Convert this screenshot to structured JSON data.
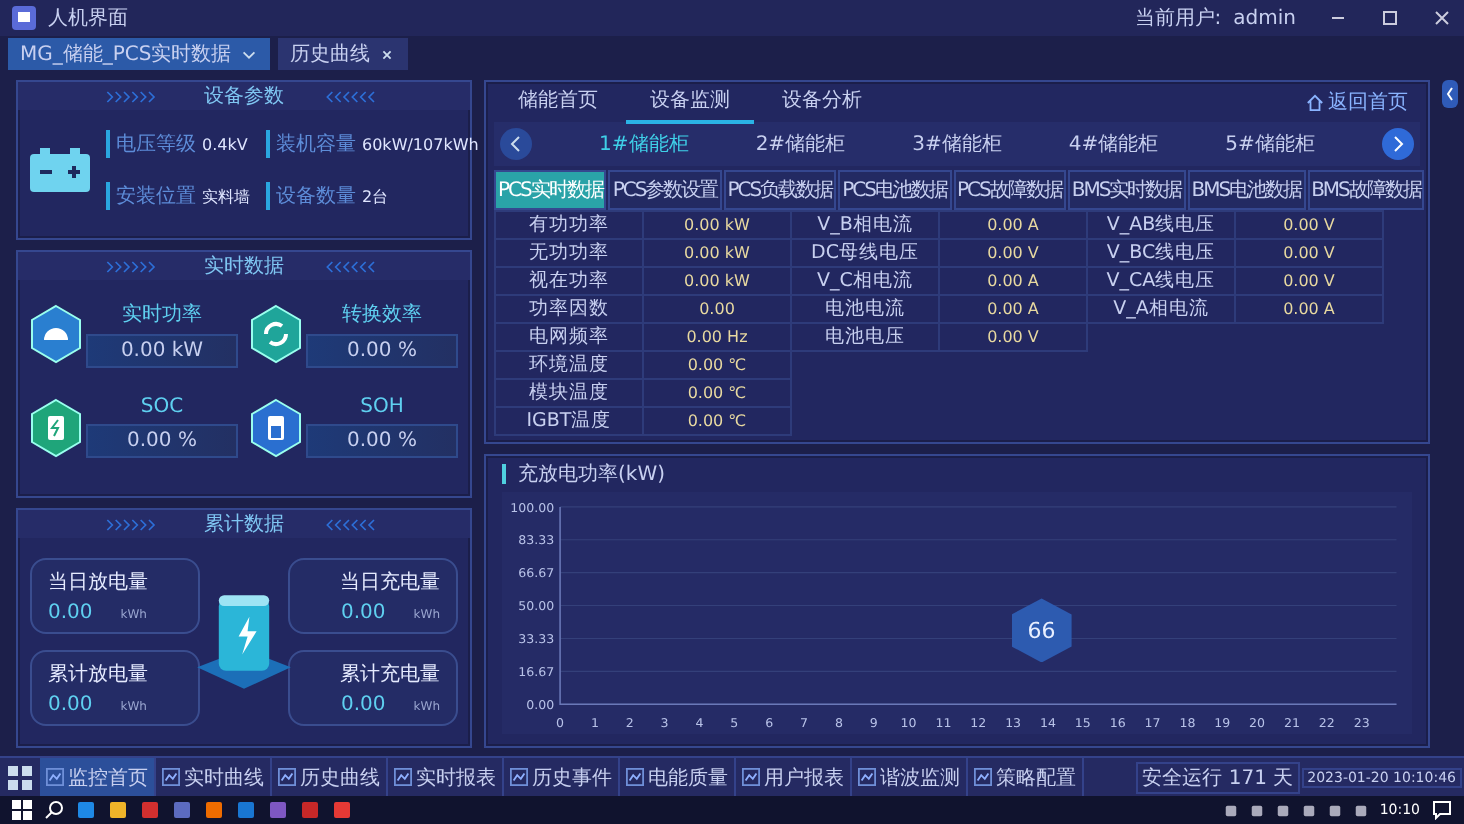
{
  "window": {
    "title": "人机界面",
    "user_label": "当前用户:",
    "user": "admin"
  },
  "doc_tabs": [
    {
      "label": "MG_储能_PCS实时数据",
      "selected": true
    },
    {
      "label": "历史曲线",
      "selected": false
    }
  ],
  "device_params": {
    "title": "设备参数",
    "fields": [
      {
        "label": "电压等级",
        "value": "0.4kV"
      },
      {
        "label": "装机容量",
        "value": "60kW/107kWh"
      },
      {
        "label": "安装位置",
        "value": "实料墙"
      },
      {
        "label": "设备数量",
        "value": "2台"
      }
    ]
  },
  "realtime": {
    "title": "实时数据",
    "metrics": [
      {
        "label": "实时功率",
        "value": "0.00 kW",
        "kind": "gauge"
      },
      {
        "label": "转换效率",
        "value": "0.00 %",
        "kind": "cycle"
      },
      {
        "label": "SOC",
        "value": "0.00 %",
        "kind": "charge"
      },
      {
        "label": "SOH",
        "value": "0.00 %",
        "kind": "battery"
      }
    ]
  },
  "cumulative": {
    "title": "累计数据",
    "items": [
      {
        "label": "当日放电量",
        "value": "0.00",
        "unit": "kWh"
      },
      {
        "label": "当日充电量",
        "value": "0.00",
        "unit": "kWh"
      },
      {
        "label": "累计放电量",
        "value": "0.00",
        "unit": "kWh"
      },
      {
        "label": "累计充电量",
        "value": "0.00",
        "unit": "kWh"
      }
    ]
  },
  "main_tabs": [
    {
      "label": "储能首页",
      "selected": false
    },
    {
      "label": "设备监测",
      "selected": true
    },
    {
      "label": "设备分析",
      "selected": false
    }
  ],
  "home_link": "返回首页",
  "cabinets": [
    {
      "label": "1#储能柜",
      "selected": true
    },
    {
      "label": "2#储能柜",
      "selected": false
    },
    {
      "label": "3#储能柜",
      "selected": false
    },
    {
      "label": "4#储能柜",
      "selected": false
    },
    {
      "label": "5#储能柜",
      "selected": false
    }
  ],
  "data_tabs": [
    {
      "label": "PCS实时数据",
      "selected": true
    },
    {
      "label": "PCS参数设置",
      "selected": false
    },
    {
      "label": "PCS负载数据",
      "selected": false
    },
    {
      "label": "PCS电池数据",
      "selected": false
    },
    {
      "label": "PCS故障数据",
      "selected": false
    },
    {
      "label": "BMS实时数据",
      "selected": false
    },
    {
      "label": "BMS电池数据",
      "selected": false
    },
    {
      "label": "BMS故障数据",
      "selected": false
    }
  ],
  "table": {
    "groups": [
      {
        "rows": [
          {
            "label": "有功功率",
            "value": "0.00 kW"
          },
          {
            "label": "无功功率",
            "value": "0.00 kW"
          },
          {
            "label": "视在功率",
            "value": "0.00 kW"
          },
          {
            "label": "功率因数",
            "value": "0.00"
          },
          {
            "label": "电网频率",
            "value": "0.00 Hz"
          },
          {
            "label": "环境温度",
            "value": "0.00 ℃"
          },
          {
            "label": "模块温度",
            "value": "0.00 ℃"
          },
          {
            "label": "IGBT温度",
            "value": "0.00 ℃"
          }
        ]
      },
      {
        "rows": [
          {
            "label": "V_B相电流",
            "value": "0.00 A"
          },
          {
            "label": "DC母线电压",
            "value": "0.00 V"
          },
          {
            "label": "V_C相电流",
            "value": "0.00 A"
          },
          {
            "label": "电池电流",
            "value": "0.00 A"
          },
          {
            "label": "电池电压",
            "value": "0.00 V"
          }
        ]
      },
      {
        "rows": [
          {
            "label": "V_AB线电压",
            "value": "0.00 V"
          },
          {
            "label": "V_BC线电压",
            "value": "0.00 V"
          },
          {
            "label": "V_CA线电压",
            "value": "0.00 V"
          },
          {
            "label": "V_A相电流",
            "value": "0.00 A"
          }
        ]
      }
    ]
  },
  "chart": {
    "title": "充放电功率(kW)",
    "chart_data": {
      "type": "line",
      "grid": true,
      "xlim": [
        0,
        24
      ],
      "ylim": [
        0,
        100
      ],
      "xticks": [
        0,
        1,
        2,
        3,
        4,
        5,
        6,
        7,
        8,
        9,
        10,
        11,
        12,
        13,
        14,
        15,
        16,
        17,
        18,
        19,
        20,
        21,
        22,
        23
      ],
      "yticks": [
        {
          "value": 0,
          "label": "0.00"
        },
        {
          "value": 16.67,
          "label": "16.67"
        },
        {
          "value": 33.33,
          "label": "33.33"
        },
        {
          "value": 50,
          "label": "50.00"
        },
        {
          "value": 66.67,
          "label": "66.67"
        },
        {
          "value": 83.33,
          "label": "83.33"
        },
        {
          "value": 100,
          "label": "100.00"
        }
      ]
    }
  },
  "floating_badge": {
    "value": "66"
  },
  "bottom_nav": [
    {
      "label": "监控首页",
      "selected": true
    },
    {
      "label": "实时曲线",
      "selected": false
    },
    {
      "label": "历史曲线",
      "selected": false
    },
    {
      "label": "实时报表",
      "selected": false
    },
    {
      "label": "历史事件",
      "selected": false
    },
    {
      "label": "电能质量",
      "selected": false
    },
    {
      "label": "用户报表",
      "selected": false
    },
    {
      "label": "谐波监测",
      "selected": false
    },
    {
      "label": "策略配置",
      "selected": false
    }
  ],
  "status": {
    "runtime": "安全运行 171 天",
    "datetime": "2023-01-20 10:10:46"
  },
  "taskbar": {
    "time": "10:10"
  }
}
